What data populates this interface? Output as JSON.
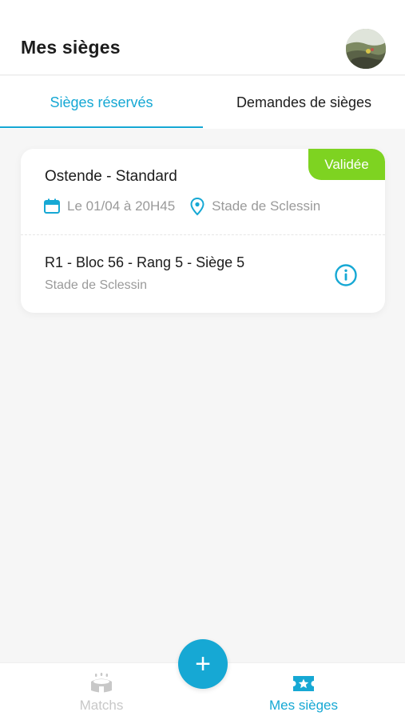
{
  "header": {
    "title": "Mes sièges"
  },
  "tabs": [
    {
      "label": "Sièges réservés",
      "active": true
    },
    {
      "label": "Demandes de sièges",
      "active": false
    }
  ],
  "reservation": {
    "status": "Validée",
    "match": "Ostende - Standard",
    "date": "Le 01/04 à 20H45",
    "venue": "Stade de Sclessin",
    "seat": "R1 - Bloc 56 - Rang 5 - Siège 5",
    "seat_venue": "Stade de Sclessin"
  },
  "fab": {
    "label": "+"
  },
  "bottom_nav": [
    {
      "label": "Matchs",
      "icon": "stadium-icon",
      "active": false
    },
    {
      "label": "Mes sièges",
      "icon": "ticket-star-icon",
      "active": true
    }
  ],
  "colors": {
    "accent": "#16a8d4",
    "status_validated": "#7ed321",
    "muted": "#9a9a9a",
    "background": "#f6f6f6"
  }
}
